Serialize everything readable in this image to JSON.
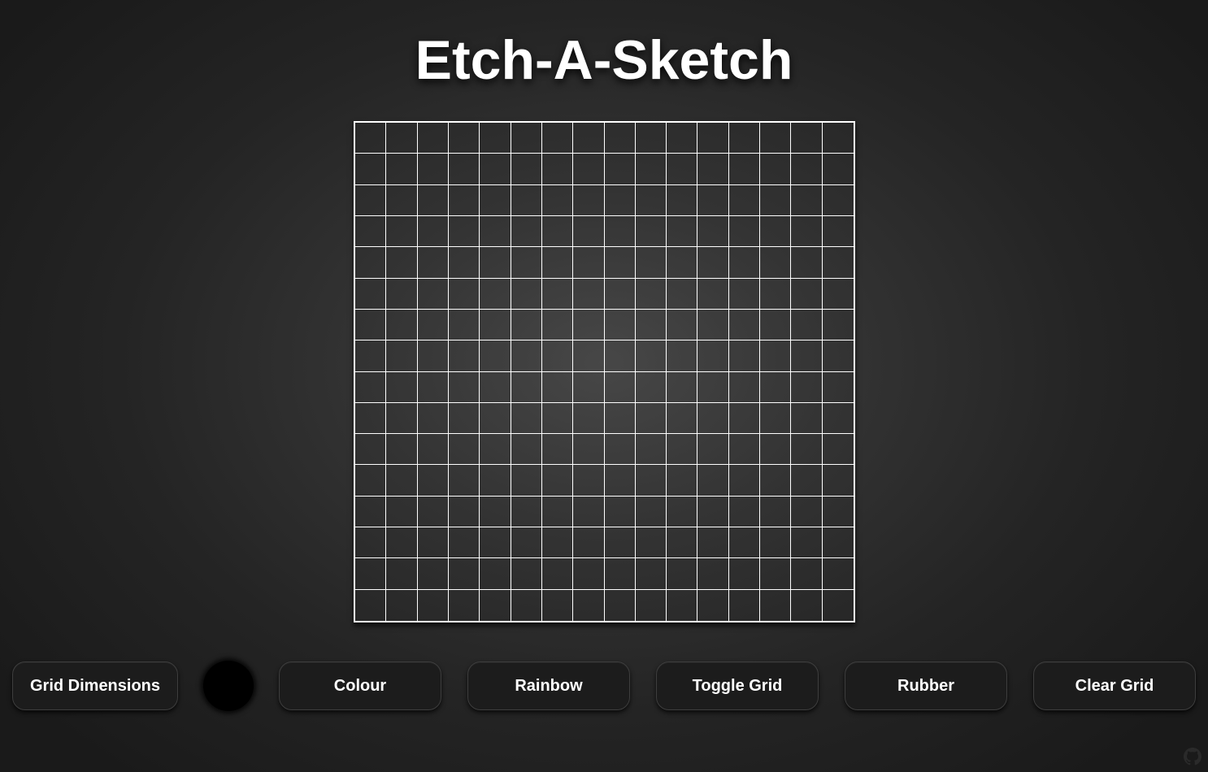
{
  "page": {
    "title": "Etch-A-Sketch"
  },
  "grid": {
    "rows": 16,
    "columns": 16,
    "line_color": "#ffffff"
  },
  "controls": {
    "grid_dimensions_label": "Grid Dimensions",
    "colour_picker_value": "#000000",
    "colour_label": "Colour",
    "rainbow_label": "Rainbow",
    "toggle_grid_label": "Toggle Grid",
    "rubber_label": "Rubber",
    "clear_grid_label": "Clear Grid"
  },
  "footer": {
    "icon": "github-icon"
  }
}
